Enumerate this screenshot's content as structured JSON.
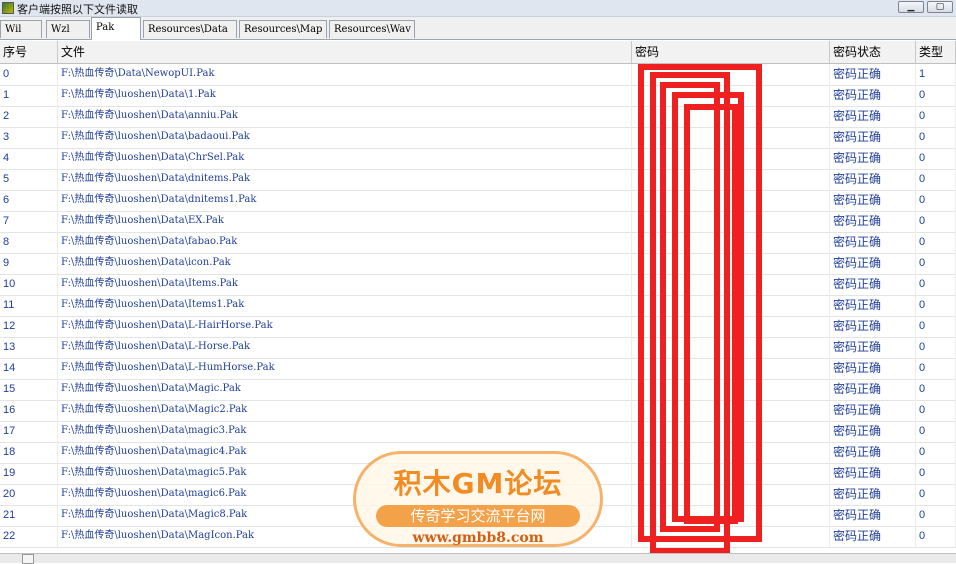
{
  "window": {
    "title": "客户端按照以下文件读取",
    "minimize_glyph": "▁",
    "restore_glyph": "▢"
  },
  "tabs": [
    {
      "label": "Wil"
    },
    {
      "label": "Wzl"
    },
    {
      "label": "Pak"
    },
    {
      "label": "Resources\\Data"
    },
    {
      "label": "Resources\\Map"
    },
    {
      "label": "Resources\\Wav"
    }
  ],
  "active_tab": "Pak",
  "table": {
    "columns": [
      "序号",
      "文件",
      "密码",
      "密码状态",
      "类型"
    ],
    "rows": [
      {
        "no": "0",
        "file": "F:\\热血传奇\\Data\\NewopUI.Pak",
        "pwd": "",
        "status": "密码正确",
        "type": "1"
      },
      {
        "no": "1",
        "file": "F:\\热血传奇\\luoshen\\Data\\1.Pak",
        "pwd": "",
        "status": "密码正确",
        "type": "0"
      },
      {
        "no": "2",
        "file": "F:\\热血传奇\\luoshen\\Data\\anniu.Pak",
        "pwd": "",
        "status": "密码正确",
        "type": "0"
      },
      {
        "no": "3",
        "file": "F:\\热血传奇\\luoshen\\Data\\badaoui.Pak",
        "pwd": "",
        "status": "密码正确",
        "type": "0"
      },
      {
        "no": "4",
        "file": "F:\\热血传奇\\luoshen\\Data\\ChrSel.Pak",
        "pwd": "",
        "status": "密码正确",
        "type": "0"
      },
      {
        "no": "5",
        "file": "F:\\热血传奇\\luoshen\\Data\\dnitems.Pak",
        "pwd": "",
        "status": "密码正确",
        "type": "0"
      },
      {
        "no": "6",
        "file": "F:\\热血传奇\\luoshen\\Data\\dnitems1.Pak",
        "pwd": "",
        "status": "密码正确",
        "type": "0"
      },
      {
        "no": "7",
        "file": "F:\\热血传奇\\luoshen\\Data\\EX.Pak",
        "pwd": "",
        "status": "密码正确",
        "type": "0"
      },
      {
        "no": "8",
        "file": "F:\\热血传奇\\luoshen\\Data\\fabao.Pak",
        "pwd": "",
        "status": "密码正确",
        "type": "0"
      },
      {
        "no": "9",
        "file": "F:\\热血传奇\\luoshen\\Data\\icon.Pak",
        "pwd": "",
        "status": "密码正确",
        "type": "0"
      },
      {
        "no": "10",
        "file": "F:\\热血传奇\\luoshen\\Data\\Items.Pak",
        "pwd": "",
        "status": "密码正确",
        "type": "0"
      },
      {
        "no": "11",
        "file": "F:\\热血传奇\\luoshen\\Data\\Items1.Pak",
        "pwd": "",
        "status": "密码正确",
        "type": "0"
      },
      {
        "no": "12",
        "file": "F:\\热血传奇\\luoshen\\Data\\L-HairHorse.Pak",
        "pwd": "",
        "status": "密码正确",
        "type": "0"
      },
      {
        "no": "13",
        "file": "F:\\热血传奇\\luoshen\\Data\\L-Horse.Pak",
        "pwd": "",
        "status": "密码正确",
        "type": "0"
      },
      {
        "no": "14",
        "file": "F:\\热血传奇\\luoshen\\Data\\L-HumHorse.Pak",
        "pwd": "",
        "status": "密码正确",
        "type": "0"
      },
      {
        "no": "15",
        "file": "F:\\热血传奇\\luoshen\\Data\\Magic.Pak",
        "pwd": "",
        "status": "密码正确",
        "type": "0"
      },
      {
        "no": "16",
        "file": "F:\\热血传奇\\luoshen\\Data\\Magic2.Pak",
        "pwd": "",
        "status": "密码正确",
        "type": "0"
      },
      {
        "no": "17",
        "file": "F:\\热血传奇\\luoshen\\Data\\magic3.Pak",
        "pwd": "",
        "status": "密码正确",
        "type": "0"
      },
      {
        "no": "18",
        "file": "F:\\热血传奇\\luoshen\\Data\\magic4.Pak",
        "pwd": "",
        "status": "密码正确",
        "type": "0"
      },
      {
        "no": "19",
        "file": "F:\\热血传奇\\luoshen\\Data\\magic5.Pak",
        "pwd": "",
        "status": "密码正确",
        "type": "0"
      },
      {
        "no": "20",
        "file": "F:\\热血传奇\\luoshen\\Data\\magic6.Pak",
        "pwd": "",
        "status": "密码正确",
        "type": "0"
      },
      {
        "no": "21",
        "file": "F:\\热血传奇\\luoshen\\Data\\Magic8.Pak",
        "pwd": "",
        "status": "密码正确",
        "type": "0"
      },
      {
        "no": "22",
        "file": "F:\\热血传奇\\luoshen\\Data\\MagIcon.Pak",
        "pwd": "",
        "status": "密码正确",
        "type": "0"
      }
    ]
  },
  "watermark": {
    "title": "积木GM论坛",
    "subtitle": "传奇学习交流平台网",
    "url": "www.gmbb8.com"
  },
  "colors": {
    "row_text": "#1f3f99",
    "redaction": "#ee2020",
    "watermark": "#f28b22"
  }
}
